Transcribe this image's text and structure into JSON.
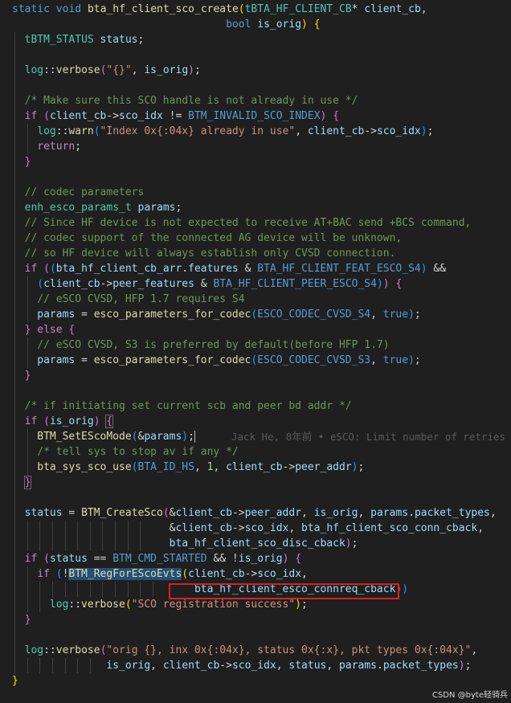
{
  "watermark": "CSDN @byte轻骑兵",
  "blame_annotation": "Jack He, 8年前 • eSCO: Limit number of retries",
  "lines": [
    [
      [
        "kw",
        "static"
      ],
      [
        "op",
        " "
      ],
      [
        "kw",
        "void"
      ],
      [
        "op",
        " "
      ],
      [
        "fn",
        "bta_hf_client_sco_create"
      ],
      [
        "br1",
        "("
      ],
      [
        "typ",
        "tBTA_HF_CLIENT_CB"
      ],
      [
        "op",
        "* "
      ],
      [
        "var",
        "client_cb"
      ],
      [
        "op",
        ","
      ]
    ],
    [
      [
        "op",
        "                                  "
      ],
      [
        "kw",
        "bool"
      ],
      [
        "op",
        " "
      ],
      [
        "var",
        "is_orig"
      ],
      [
        "br1",
        ")"
      ],
      [
        "op",
        " "
      ],
      [
        "br1",
        "{"
      ]
    ],
    [
      [
        "typ",
        "tBTM_STATUS"
      ],
      [
        "op",
        " "
      ],
      [
        "var",
        "status"
      ],
      [
        "op",
        ";"
      ]
    ],
    [],
    [
      [
        "typ",
        "log"
      ],
      [
        "op",
        "::"
      ],
      [
        "fn",
        "verbose"
      ],
      [
        "br2",
        "("
      ],
      [
        "str",
        "\"{}\""
      ],
      [
        "op",
        ", "
      ],
      [
        "var",
        "is_orig"
      ],
      [
        "br2",
        ")"
      ],
      [
        "op",
        ";"
      ]
    ],
    [],
    [
      [
        "cmt",
        "/* Make sure this SCO handle is not already in use */"
      ]
    ],
    [
      [
        "ctl",
        "if"
      ],
      [
        "op",
        " "
      ],
      [
        "br2",
        "("
      ],
      [
        "var",
        "client_cb"
      ],
      [
        "op",
        "->"
      ],
      [
        "var",
        "sco_idx"
      ],
      [
        "op",
        " != "
      ],
      [
        "mac",
        "BTM_INVALID_SCO_INDEX"
      ],
      [
        "br2",
        ")"
      ],
      [
        "op",
        " "
      ],
      [
        "br2",
        "{"
      ]
    ],
    [
      [
        "typ",
        "log"
      ],
      [
        "op",
        "::"
      ],
      [
        "fn",
        "warn"
      ],
      [
        "br3",
        "("
      ],
      [
        "str",
        "\"Index 0x{:04x} already in use\""
      ],
      [
        "op",
        ", "
      ],
      [
        "var",
        "client_cb"
      ],
      [
        "op",
        "->"
      ],
      [
        "var",
        "sco_idx"
      ],
      [
        "br3",
        ")"
      ],
      [
        "op",
        ";"
      ]
    ],
    [
      [
        "ctl",
        "return"
      ],
      [
        "op",
        ";"
      ]
    ],
    [
      [
        "br2",
        "}"
      ]
    ],
    [],
    [
      [
        "cmt",
        "// codec parameters"
      ]
    ],
    [
      [
        "typ",
        "enh_esco_params_t"
      ],
      [
        "op",
        " "
      ],
      [
        "var",
        "params"
      ],
      [
        "op",
        ";"
      ]
    ],
    [
      [
        "cmt",
        "// Since HF device is not expected to receive AT+BAC send +BCS command,"
      ]
    ],
    [
      [
        "cmt",
        "// codec support of the connected AG device will be unknown,"
      ]
    ],
    [
      [
        "cmt",
        "// so HF device will always establish only CVSD connection."
      ]
    ],
    [
      [
        "ctl",
        "if"
      ],
      [
        "op",
        " "
      ],
      [
        "br2",
        "("
      ],
      [
        "br3",
        "("
      ],
      [
        "var",
        "bta_hf_client_cb_arr"
      ],
      [
        "op",
        "."
      ],
      [
        "var",
        "features"
      ],
      [
        "op",
        " & "
      ],
      [
        "mac",
        "BTA_HF_CLIENT_FEAT_ESCO_S4"
      ],
      [
        "br3",
        ")"
      ],
      [
        "op",
        " &&"
      ]
    ],
    [
      [
        "op",
        "  "
      ],
      [
        "br3",
        "("
      ],
      [
        "var",
        "client_cb"
      ],
      [
        "op",
        "->"
      ],
      [
        "var",
        "peer_features"
      ],
      [
        "op",
        " & "
      ],
      [
        "mac",
        "BTA_HF_CLIENT_PEER_ESCO_S4"
      ],
      [
        "br3",
        ")"
      ],
      [
        "br2",
        ")"
      ],
      [
        "op",
        " "
      ],
      [
        "br2",
        "{"
      ]
    ],
    [
      [
        "cmt",
        "// eSCO CVSD, HFP 1.7 requires S4"
      ]
    ],
    [
      [
        "var",
        "params"
      ],
      [
        "op",
        " = "
      ],
      [
        "fn",
        "esco_parameters_for_codec"
      ],
      [
        "br3",
        "("
      ],
      [
        "mac",
        "ESCO_CODEC_CVSD_S4"
      ],
      [
        "op",
        ", "
      ],
      [
        "kw",
        "true"
      ],
      [
        "br3",
        ")"
      ],
      [
        "op",
        ";"
      ]
    ],
    [
      [
        "br2",
        "}"
      ],
      [
        "op",
        " "
      ],
      [
        "ctl",
        "else"
      ],
      [
        "op",
        " "
      ],
      [
        "br2",
        "{"
      ]
    ],
    [
      [
        "cmt",
        "// eSCO CVSD, S3 is preferred by default(before HFP 1.7)"
      ]
    ],
    [
      [
        "var",
        "params"
      ],
      [
        "op",
        " = "
      ],
      [
        "fn",
        "esco_parameters_for_codec"
      ],
      [
        "br3",
        "("
      ],
      [
        "mac",
        "ESCO_CODEC_CVSD_S3"
      ],
      [
        "op",
        ", "
      ],
      [
        "kw",
        "true"
      ],
      [
        "br3",
        ")"
      ],
      [
        "op",
        ";"
      ]
    ],
    [
      [
        "br2",
        "}"
      ]
    ],
    [],
    [
      [
        "cmt",
        "/* if initiating set current scb and peer bd addr */"
      ]
    ],
    [
      [
        "ctl",
        "if"
      ],
      [
        "op",
        " "
      ],
      [
        "br2",
        "("
      ],
      [
        "var",
        "is_orig"
      ],
      [
        "br2",
        ")"
      ],
      [
        "op",
        " "
      ],
      [
        "br2",
        "{"
      ]
    ],
    [
      [
        "fn",
        "BTM_SetEScoMode"
      ],
      [
        "br3",
        "("
      ],
      [
        "op",
        "&"
      ],
      [
        "var",
        "params"
      ],
      [
        "br3",
        ")"
      ],
      [
        "op",
        ";"
      ]
    ],
    [
      [
        "cmt",
        "/* tell sys to stop av if any */"
      ]
    ],
    [
      [
        "fn",
        "bta_sys_sco_use"
      ],
      [
        "br3",
        "("
      ],
      [
        "mac",
        "BTA_ID_HS"
      ],
      [
        "op",
        ", "
      ],
      [
        "num",
        "1"
      ],
      [
        "op",
        ", "
      ],
      [
        "var",
        "client_cb"
      ],
      [
        "op",
        "->"
      ],
      [
        "var",
        "peer_addr"
      ],
      [
        "br3",
        ")"
      ],
      [
        "op",
        ";"
      ]
    ],
    [
      [
        "br2",
        "}"
      ]
    ],
    [],
    [
      [
        "var",
        "status"
      ],
      [
        "op",
        " = "
      ],
      [
        "fn",
        "BTM_CreateSco"
      ],
      [
        "br2",
        "("
      ],
      [
        "op",
        "&"
      ],
      [
        "var",
        "client_cb"
      ],
      [
        "op",
        "->"
      ],
      [
        "var",
        "peer_addr"
      ],
      [
        "op",
        ", "
      ],
      [
        "var",
        "is_orig"
      ],
      [
        "op",
        ", "
      ],
      [
        "var",
        "params"
      ],
      [
        "op",
        "."
      ],
      [
        "var",
        "packet_types"
      ],
      [
        "op",
        ","
      ]
    ],
    [
      [
        "op",
        "                       &"
      ],
      [
        "var",
        "client_cb"
      ],
      [
        "op",
        "->"
      ],
      [
        "var",
        "sco_idx"
      ],
      [
        "op",
        ", "
      ],
      [
        "var",
        "bta_hf_client_sco_conn_cback"
      ],
      [
        "op",
        ","
      ]
    ],
    [
      [
        "op",
        "                       "
      ],
      [
        "var",
        "bta_hf_client_sco_disc_cback"
      ],
      [
        "br2",
        ")"
      ],
      [
        "op",
        ";"
      ]
    ],
    [
      [
        "ctl",
        "if"
      ],
      [
        "op",
        " "
      ],
      [
        "br2",
        "("
      ],
      [
        "var",
        "status"
      ],
      [
        "op",
        " == "
      ],
      [
        "mac",
        "BTM_CMD_STARTED"
      ],
      [
        "op",
        " && !"
      ],
      [
        "var",
        "is_orig"
      ],
      [
        "br2",
        ")"
      ],
      [
        "op",
        " "
      ],
      [
        "br2",
        "{"
      ]
    ],
    [
      [
        "ctl",
        "if"
      ],
      [
        "op",
        " "
      ],
      [
        "br3",
        "("
      ],
      [
        "op",
        "!"
      ],
      [
        "fn",
        "BTM_RegForEScoEvts"
      ],
      [
        "br1",
        "("
      ],
      [
        "var",
        "client_cb"
      ],
      [
        "op",
        "->"
      ],
      [
        "var",
        "sco_idx"
      ],
      [
        "op",
        ","
      ]
    ],
    [
      [
        "op",
        "                         "
      ],
      [
        "var",
        "bta_hf_client_esco_connreq_cback"
      ],
      [
        "br1",
        ")"
      ],
      [
        "br3",
        ")"
      ]
    ],
    [
      [
        "typ",
        "log"
      ],
      [
        "op",
        "::"
      ],
      [
        "fn",
        "verbose"
      ],
      [
        "br1",
        "("
      ],
      [
        "str",
        "\"SCO registration success\""
      ],
      [
        "br1",
        ")"
      ],
      [
        "op",
        ";"
      ]
    ],
    [
      [
        "br2",
        "}"
      ]
    ],
    [],
    [
      [
        "typ",
        "log"
      ],
      [
        "op",
        "::"
      ],
      [
        "fn",
        "verbose"
      ],
      [
        "br2",
        "("
      ],
      [
        "str",
        "\"orig {}, inx 0x{:04x}, status 0x{:x}, pkt types 0x{:04x}\""
      ],
      [
        "op",
        ","
      ]
    ],
    [
      [
        "op",
        "             "
      ],
      [
        "var",
        "is_orig"
      ],
      [
        "op",
        ", "
      ],
      [
        "var",
        "client_cb"
      ],
      [
        "op",
        "->"
      ],
      [
        "var",
        "sco_idx"
      ],
      [
        "op",
        ", "
      ],
      [
        "var",
        "status"
      ],
      [
        "op",
        ", "
      ],
      [
        "var",
        "params"
      ],
      [
        "op",
        "."
      ],
      [
        "var",
        "packet_types"
      ],
      [
        "br2",
        ")"
      ],
      [
        "op",
        ";"
      ]
    ],
    [
      [
        "br1",
        "}"
      ]
    ]
  ]
}
